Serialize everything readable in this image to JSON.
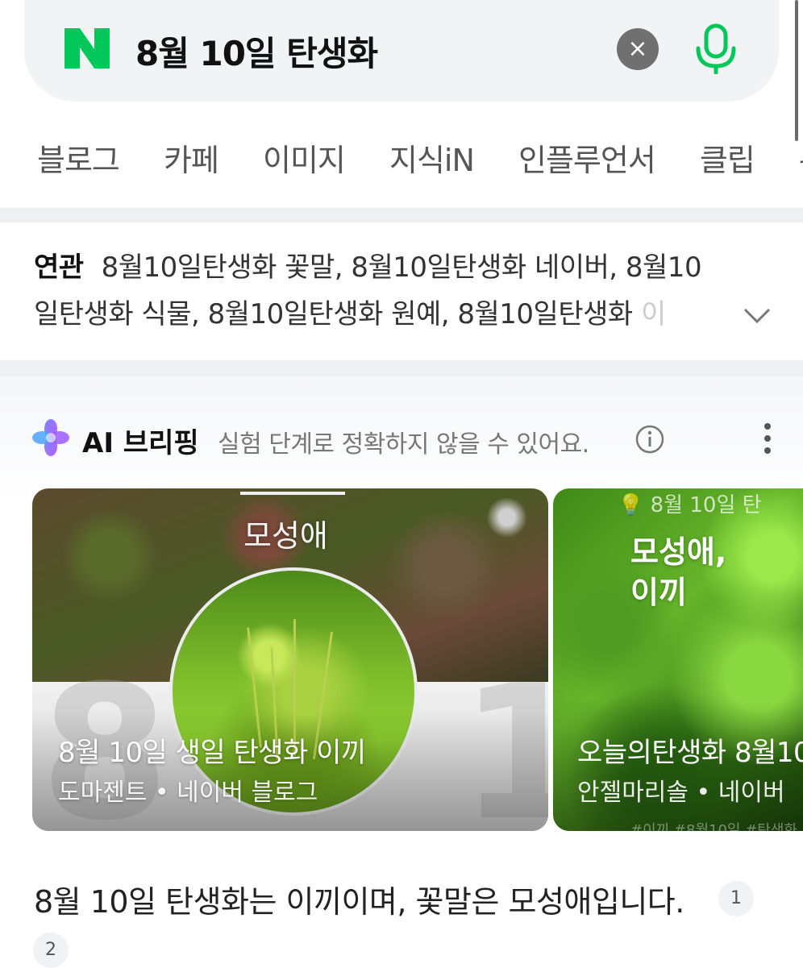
{
  "search": {
    "query": "8월 10일 탄생화",
    "logo_text": "N",
    "brand_color": "#03c75a"
  },
  "tabs": [
    "블로그",
    "카페",
    "이미지",
    "지식iN",
    "인플루언서",
    "클립",
    "뉴"
  ],
  "related": {
    "heading": "연관",
    "line1": "8월10일탄생화 꽃말, 8월10일탄생화 네이버, 8월10",
    "line2": "일탄생화 식물, 8월10일탄생화 원예, 8월10일탄생화 ",
    "line2_fade": "이"
  },
  "ai_briefing": {
    "title": "AI 브리핑",
    "note": "실험 단계로 정확하지 않을 수 있어요.",
    "cards": [
      {
        "overlay_text": "모성애",
        "title": "8월 10일 생일 탄생화 이끼",
        "source": "도마젠트 • 네이버 블로그",
        "bg_digit_left": "8",
        "bg_digit_right": "1"
      },
      {
        "top_text": "8월 10일 탄",
        "overlay_line1": "모성애,",
        "overlay_line2": "이끼",
        "title": "오늘의탄생화 8월10",
        "source": "안젤마리솔 • 네이버",
        "tags": "#이끼 #8월10일 #탄생화"
      }
    ],
    "answer": "8월 10일 탄생화는 이끼이며, 꽃말은 모성애입니다.",
    "citations": [
      "1",
      "2"
    ]
  }
}
